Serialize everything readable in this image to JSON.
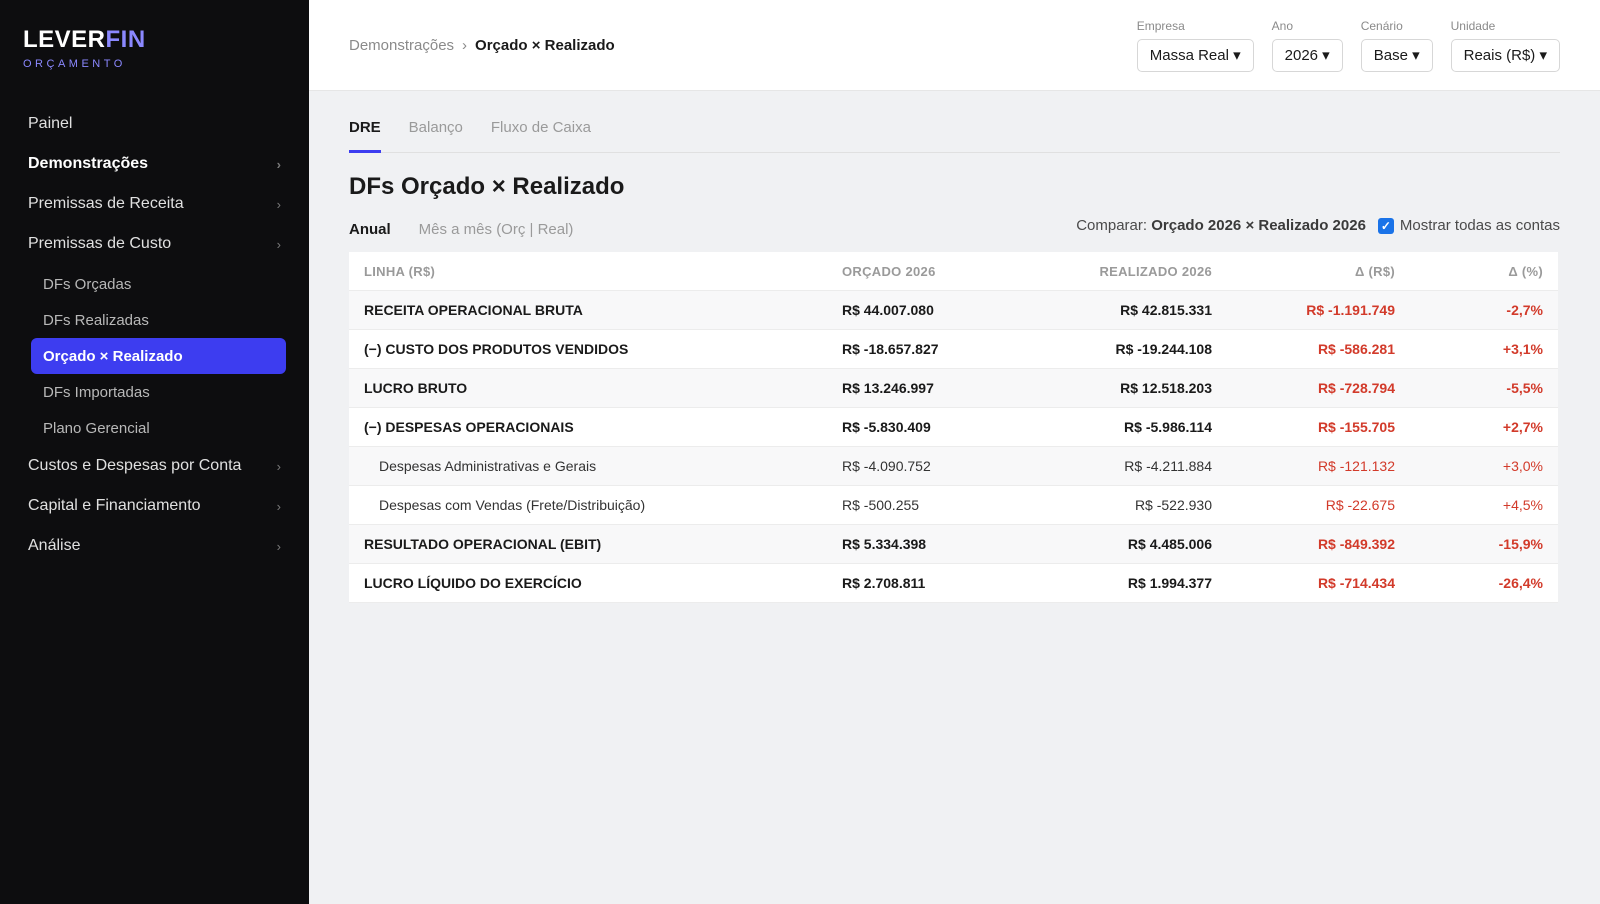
{
  "brand": {
    "name_part1": "LEVER",
    "name_part2": "FIN",
    "subtitle": "ORÇAMENTO"
  },
  "sidebar": {
    "items": [
      {
        "label": "Painel",
        "chevron": false,
        "bold": false
      },
      {
        "label": "Demonstrações",
        "chevron": true,
        "bold": true
      },
      {
        "label": "Premissas de Receita",
        "chevron": true,
        "bold": false
      },
      {
        "label": "Premissas de Custo",
        "chevron": true,
        "bold": false
      }
    ],
    "subitems": [
      {
        "label": "DFs Orçadas",
        "active": false
      },
      {
        "label": "DFs Realizadas",
        "active": false
      },
      {
        "label": "Orçado × Realizado",
        "active": true
      },
      {
        "label": "DFs Importadas",
        "active": false
      },
      {
        "label": "Plano Gerencial",
        "active": false
      }
    ],
    "items_after": [
      {
        "label": "Custos e Despesas por Conta"
      },
      {
        "label": "Capital e Financiamento"
      },
      {
        "label": "Análise"
      }
    ],
    "chevron": "›"
  },
  "breadcrumb": {
    "parent": "Demonstrações",
    "separator": "›",
    "current": "Orçado × Realizado"
  },
  "filters": [
    {
      "label": "Empresa",
      "value": "Massa Real ▾"
    },
    {
      "label": "Ano",
      "value": "2026 ▾"
    },
    {
      "label": "Cenário",
      "value": "Base ▾"
    },
    {
      "label": "Unidade",
      "value": "Reais (R$) ▾"
    }
  ],
  "tabs": [
    "DRE",
    "Balanço",
    "Fluxo de Caixa"
  ],
  "title": "DFs Orçado × Realizado",
  "views": [
    "Anual",
    "Mês a mês (Orç | Real)"
  ],
  "compare": {
    "prefix": "Comparar:",
    "value": "Orçado 2026 × Realizado 2026",
    "checkbox_label": "Mostrar todas as contas"
  },
  "table": {
    "headers": [
      "LINHA (R$)",
      "ORÇADO 2026",
      "REALIZADO 2026",
      "Δ (R$)",
      "Δ (%)"
    ],
    "rows": [
      {
        "line": "RECEITA OPERACIONAL BRUTA",
        "orcado": "R$ 44.007.080",
        "realizado": "R$ 42.815.331",
        "delta": "R$ -1.191.749",
        "pct": "-2,7%",
        "type": "bold"
      },
      {
        "line": "(−) CUSTO DOS PRODUTOS VENDIDOS",
        "orcado": "R$ -18.657.827",
        "realizado": "R$ -19.244.108",
        "delta": "R$ -586.281",
        "pct": "+3,1%",
        "type": "bold"
      },
      {
        "line": "LUCRO BRUTO",
        "orcado": "R$ 13.246.997",
        "realizado": "R$ 12.518.203",
        "delta": "R$ -728.794",
        "pct": "-5,5%",
        "type": "bold"
      },
      {
        "line": "(−) DESPESAS OPERACIONAIS",
        "orcado": "R$ -5.830.409",
        "realizado": "R$ -5.986.114",
        "delta": "R$ -155.705",
        "pct": "+2,7%",
        "type": "bold"
      },
      {
        "line": "Despesas Administrativas e Gerais",
        "orcado": "R$ -4.090.752",
        "realizado": "R$ -4.211.884",
        "delta": "R$ -121.132",
        "pct": "+3,0%",
        "type": "sub"
      },
      {
        "line": "Despesas com Vendas (Frete/Distribuição)",
        "orcado": "R$ -500.255",
        "realizado": "R$ -522.930",
        "delta": "R$ -22.675",
        "pct": "+4,5%",
        "type": "sub"
      },
      {
        "line": "RESULTADO OPERACIONAL (EBIT)",
        "orcado": "R$ 5.334.398",
        "realizado": "R$ 4.485.006",
        "delta": "R$ -849.392",
        "pct": "-15,9%",
        "type": "bold"
      },
      {
        "line": "LUCRO LÍQUIDO DO EXERCÍCIO",
        "orcado": "R$ 2.708.811",
        "realizado": "R$ 1.994.377",
        "delta": "R$ -714.434",
        "pct": "-26,4%",
        "type": "bold"
      }
    ]
  },
  "colors": {
    "accent": "#3d3df0",
    "brand_accent": "#8b88ff",
    "negative": "#d23a2a",
    "sidebar_bg": "#0d0d0f"
  }
}
